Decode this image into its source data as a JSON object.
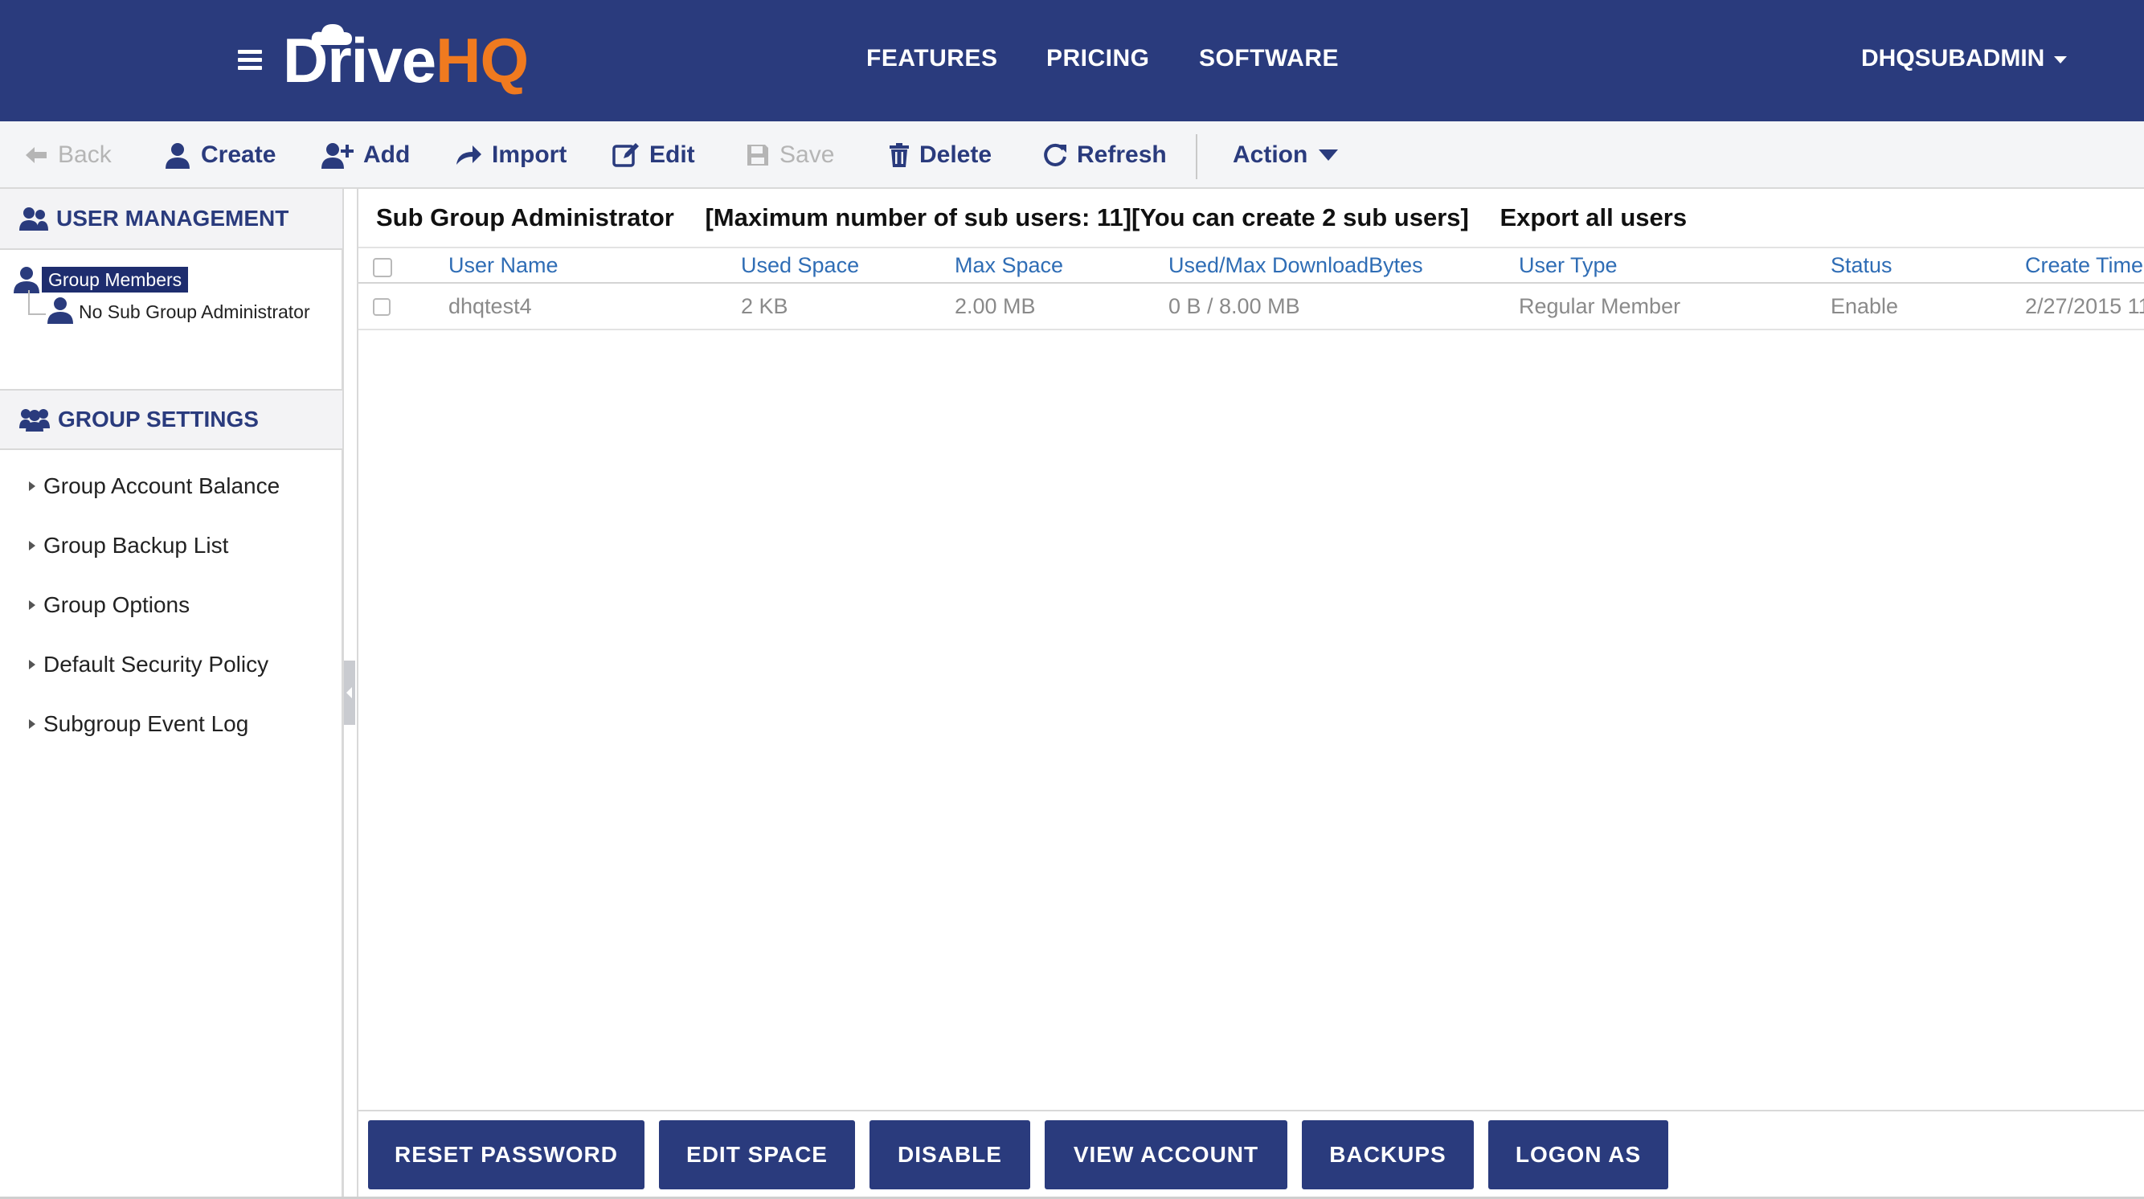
{
  "header": {
    "logo_drive": "Drive",
    "logo_hq": "HQ",
    "nav": [
      "FEATURES",
      "PRICING",
      "SOFTWARE"
    ],
    "user": "DHQSUBADMIN"
  },
  "toolbar": {
    "back": "Back",
    "create": "Create",
    "add": "Add",
    "import": "Import",
    "edit": "Edit",
    "save": "Save",
    "delete": "Delete",
    "refresh": "Refresh",
    "action": "Action"
  },
  "sidebar": {
    "user_management": "USER MANAGEMENT",
    "tree_root": "Group Members",
    "tree_child": "No Sub Group Administrator",
    "group_settings": "GROUP SETTINGS",
    "settings_items": [
      "Group Account Balance",
      "Group Backup List",
      "Group Options",
      "Default Security Policy",
      "Subgroup Event Log"
    ]
  },
  "main": {
    "title": "Sub Group Administrator",
    "limit": "[Maximum number of sub users: 11][You can create 2 sub users]",
    "export": "Export all users",
    "columns": [
      "User Name",
      "Used Space",
      "Max Space",
      "Used/Max DownloadBytes",
      "User Type",
      "Status",
      "Create Time"
    ],
    "rows": [
      [
        "dhqtest4",
        "2 KB",
        "2.00 MB",
        "0 B / 8.00 MB",
        "Regular Member",
        "Enable",
        "2/27/2015 11"
      ]
    ],
    "actions": [
      "RESET PASSWORD",
      "EDIT SPACE",
      "DISABLE",
      "VIEW ACCOUNT",
      "BACKUPS",
      "LOGON AS"
    ]
  },
  "colors": {
    "brand_navy": "#2a3b7d",
    "brand_orange": "#f07a1f",
    "link_blue": "#2f6db5"
  }
}
